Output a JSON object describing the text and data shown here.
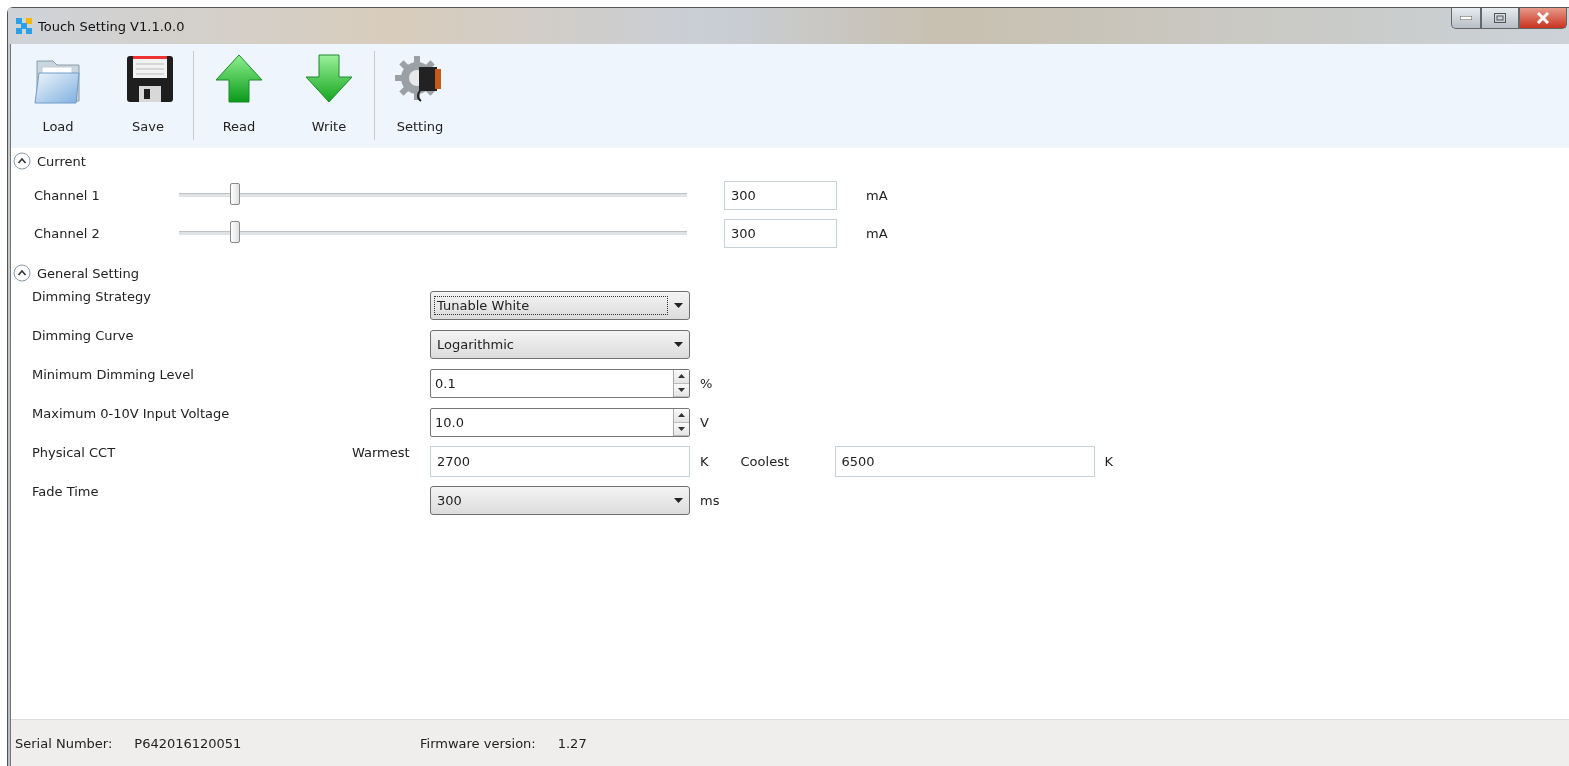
{
  "window": {
    "title": "Touch Setting V1.1.0.0"
  },
  "toolbar": {
    "groups": [
      [
        {
          "label": "Load",
          "kind": "folder"
        },
        {
          "label": "Save",
          "kind": "disk"
        }
      ],
      [
        {
          "label": "Read",
          "kind": "up"
        },
        {
          "label": "Write",
          "kind": "down"
        }
      ],
      [
        {
          "label": "Setting",
          "kind": "gear"
        }
      ]
    ]
  },
  "sections": [
    {
      "title": "Current",
      "expanded": true,
      "kind": "channels",
      "channels": [
        {
          "name": "Channel 1",
          "level": 0.11,
          "value": "300",
          "unit": "mA"
        },
        {
          "name": "Channel 2",
          "level": 0.11,
          "value": "300",
          "unit": "mA"
        }
      ]
    },
    {
      "title": "General Setting",
      "expanded": true,
      "kind": "settings",
      "rows": [
        {
          "label": "Dimming Strategy",
          "kind": "dropdown",
          "value": "Tunable White",
          "focused": true
        },
        {
          "label": "Dimming Curve",
          "kind": "dropdown",
          "value": "Logarithmic",
          "focused": false
        },
        {
          "label": "Minimum Dimming Level",
          "kind": "spinner",
          "value": "0.1",
          "unit": "%"
        },
        {
          "label": "Maximum 0-10V Input Voltage",
          "kind": "spinner",
          "value": "10.0",
          "unit": "V"
        },
        {
          "label": "Physical CCT",
          "kind": "range",
          "from_label": "Warmest",
          "from_value": "2700",
          "from_unit": "K",
          "to_label": "Coolest",
          "to_value": "6500",
          "to_unit": "K"
        },
        {
          "label": "Fade Time",
          "kind": "dropdown",
          "value": "300",
          "unit": "ms",
          "focused": false
        }
      ]
    }
  ],
  "status_bar": [
    {
      "label": "Serial Number:",
      "value": "P642016120051"
    },
    {
      "label": "Firmware version:",
      "value": "1.27"
    }
  ]
}
